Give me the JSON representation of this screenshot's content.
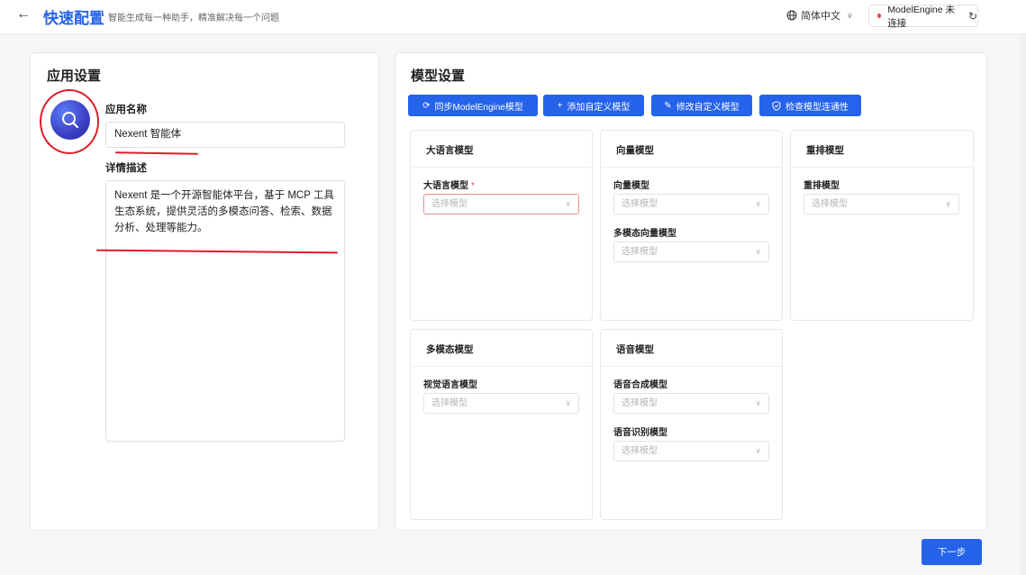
{
  "header": {
    "title": "快速配置",
    "subtitle": "智能生成每一种助手，精准解决每一个问题",
    "language": "简体中文",
    "connection_status": "ModelEngine 未连接"
  },
  "app_settings": {
    "title": "应用设置",
    "name_label": "应用名称",
    "name_value": "Nexent 智能体",
    "desc_label": "详情描述",
    "desc_value": "Nexent 是一个开源智能体平台，基于 MCP 工具生态系统，提供灵活的多模态问答、检索、数据分析、处理等能力。"
  },
  "model_settings": {
    "title": "模型设置",
    "buttons": [
      {
        "icon": "sync-icon",
        "label": "同步ModelEngine模型"
      },
      {
        "icon": "plus-icon",
        "label": "添加自定义模型"
      },
      {
        "icon": "edit-icon",
        "label": "修改自定义模型"
      },
      {
        "icon": "shield-check-icon",
        "label": "检查模型连通性"
      }
    ],
    "groups": {
      "llm": {
        "title": "大语言模型",
        "fields": [
          {
            "label": "大语言模型",
            "required": "*",
            "placeholder": "选择模型"
          }
        ]
      },
      "embedding": {
        "title": "向量模型",
        "fields": [
          {
            "label": "向量模型",
            "placeholder": "选择模型"
          },
          {
            "label": "多模态向量模型",
            "placeholder": "选择模型"
          }
        ]
      },
      "rerank": {
        "title": "重排模型",
        "fields": [
          {
            "label": "重排模型",
            "placeholder": "选择模型"
          }
        ]
      },
      "multimodal": {
        "title": "多模态模型",
        "fields": [
          {
            "label": "视觉语言模型",
            "placeholder": "选择模型"
          }
        ]
      },
      "voice": {
        "title": "语音模型",
        "fields": [
          {
            "label": "语音合成模型",
            "placeholder": "选择模型"
          },
          {
            "label": "语音识别模型",
            "placeholder": "选择模型"
          }
        ]
      }
    }
  },
  "footer": {
    "next_label": "下一步"
  },
  "colors": {
    "accent": "#2563eb",
    "annotation": "#e11d2a",
    "error": "#ef4444"
  }
}
